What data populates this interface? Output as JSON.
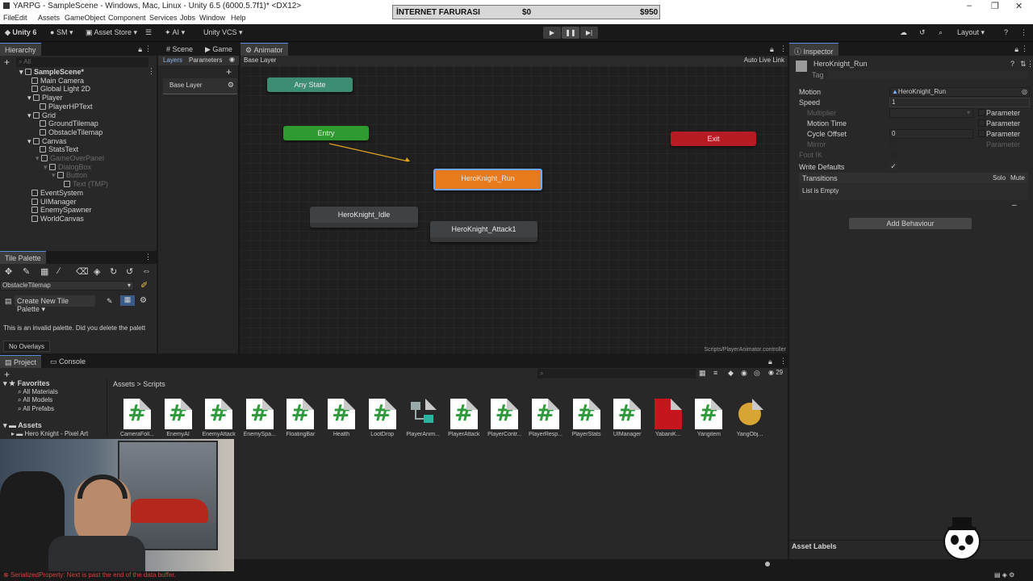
{
  "window": {
    "title": "YARPG - SampleScene - Windows, Mac, Linux - Unity 6.5 (6000.5.7f1)* <DX12>",
    "menu": [
      "File",
      "Edit",
      "Assets",
      "GameObject",
      "Component",
      "Services",
      "Jobs",
      "Window",
      "Help"
    ]
  },
  "overlay": {
    "label": "İNTERNET FARURASI",
    "left_value": "$0",
    "right_value": "$950"
  },
  "toolbar": {
    "unity_label": "Unity 6",
    "account": "SM",
    "asset_store": "Asset Store",
    "ai": "AI",
    "vcs": "Unity VCS",
    "layout": "Layout"
  },
  "hierarchy": {
    "tab": "Hierarchy",
    "search_placeholder": "All",
    "items": [
      {
        "label": "SampleScene*",
        "depth": 0,
        "dim": false
      },
      {
        "label": "Main Camera",
        "depth": 1,
        "dim": false
      },
      {
        "label": "Global Light 2D",
        "depth": 1,
        "dim": false
      },
      {
        "label": "Player",
        "depth": 1,
        "dim": false
      },
      {
        "label": "PlayerHPText",
        "depth": 2,
        "dim": false
      },
      {
        "label": "Grid",
        "depth": 1,
        "dim": false
      },
      {
        "label": "GroundTilemap",
        "depth": 2,
        "dim": false
      },
      {
        "label": "ObstacleTilemap",
        "depth": 2,
        "dim": false
      },
      {
        "label": "Canvas",
        "depth": 1,
        "dim": false
      },
      {
        "label": "StatsText",
        "depth": 2,
        "dim": false
      },
      {
        "label": "GameOverPanel",
        "depth": 2,
        "dim": true
      },
      {
        "label": "DialogBox",
        "depth": 3,
        "dim": true
      },
      {
        "label": "Button",
        "depth": 4,
        "dim": true
      },
      {
        "label": "Text (TMP)",
        "depth": 5,
        "dim": true
      },
      {
        "label": "EventSystem",
        "depth": 1,
        "dim": false
      },
      {
        "label": "UIManager",
        "depth": 1,
        "dim": false
      },
      {
        "label": "EnemySpawner",
        "depth": 1,
        "dim": false
      },
      {
        "label": "WorldCanvas",
        "depth": 1,
        "dim": false
      }
    ]
  },
  "tile_palette": {
    "tab": "Tile Palette",
    "target": "ObstacleTilemap",
    "create_button": "Create New Tile Palette",
    "message": "This is an invalid palette. Did you delete the palett",
    "overlays": "No Overlays"
  },
  "center_tabs": [
    "Scene",
    "Game",
    "Animator"
  ],
  "animator": {
    "layers_tab": "Layers",
    "parameters_tab": "Parameters",
    "breadcrumb": "Base Layer",
    "auto_live_link": "Auto Live Link",
    "layer_name": "Base Layer",
    "footer_path": "Scripts/PlayerAnimator.controller",
    "states": {
      "any_state": "Any State",
      "entry": "Entry",
      "exit": "Exit",
      "run": "HeroKnight_Run",
      "idle": "HeroKnight_Idle",
      "attack": "HeroKnight_Attack1"
    },
    "colors": {
      "any_state": "#3d8c74",
      "entry": "#2f9a2f",
      "exit": "#b71c22",
      "default_state": "#e77a1a",
      "state": "#3f4244"
    }
  },
  "inspector": {
    "tab": "Inspector",
    "name": "HeroKnight_Run",
    "tag_label": "Tag",
    "rows": {
      "motion_label": "Motion",
      "motion_value": "HeroKnight_Run",
      "speed_label": "Speed",
      "speed_value": "1",
      "multiplier_label": "Multiplier",
      "motion_time_label": "Motion Time",
      "cycle_offset_label": "Cycle Offset",
      "cycle_offset_value": "0",
      "mirror_label": "Mirror",
      "foot_ik_label": "Foot IK",
      "write_defaults_label": "Write Defaults",
      "parameter": "Parameter"
    },
    "transitions": {
      "label": "Transitions",
      "solo": "Solo",
      "mute": "Mute",
      "empty": "List is Empty"
    },
    "add_behaviour": "Add Behaviour",
    "asset_labels": "Asset Labels"
  },
  "project": {
    "tabs": [
      "Project",
      "Console"
    ],
    "favorites": {
      "title": "Favorites",
      "items": [
        "All Materials",
        "All Models",
        "All Prefabs"
      ]
    },
    "assets_tree": {
      "title": "Assets",
      "items": [
        "Hero Knight - Pixel Art"
      ]
    },
    "breadcrumb": [
      "Assets",
      "Scripts"
    ],
    "count": "29",
    "assets": [
      {
        "name": "CameraFoll...",
        "kind": "script"
      },
      {
        "name": "EnemyAI",
        "kind": "script"
      },
      {
        "name": "EnemyAttack",
        "kind": "script"
      },
      {
        "name": "EnemySpa...",
        "kind": "script"
      },
      {
        "name": "FloatingBar",
        "kind": "script"
      },
      {
        "name": "Health",
        "kind": "script"
      },
      {
        "name": "LootDrop",
        "kind": "script"
      },
      {
        "name": "PlayerAnim...",
        "kind": "animator"
      },
      {
        "name": "PlayerAttack",
        "kind": "script"
      },
      {
        "name": "PlayerContr...",
        "kind": "script"
      },
      {
        "name": "PlayerResp...",
        "kind": "script"
      },
      {
        "name": "PlayerStats",
        "kind": "script"
      },
      {
        "name": "UIManager",
        "kind": "script"
      },
      {
        "name": "YabaniK...",
        "kind": "red-prefab"
      },
      {
        "name": "Yangitem",
        "kind": "script"
      },
      {
        "name": "YangObj...",
        "kind": "gold-prefab"
      }
    ]
  },
  "status_bar": {
    "error": "SerializedProperty: Next is past the end of the data buffer."
  }
}
